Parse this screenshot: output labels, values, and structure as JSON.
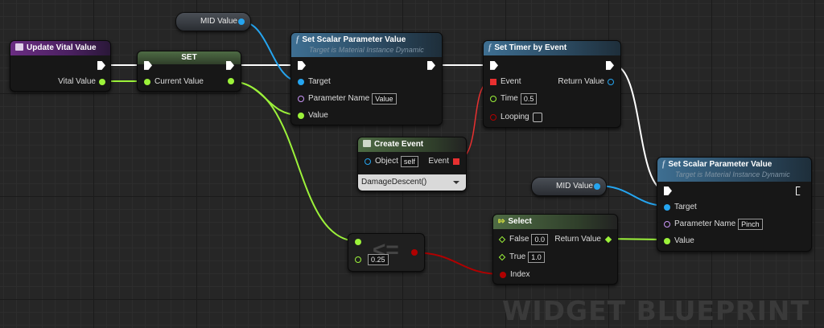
{
  "watermark": "WIDGET BLUEPRINT",
  "colors": {
    "exec": "#ffffff",
    "float": "#9cf23a",
    "object": "#25a5f0",
    "name": "#c996f7",
    "delegate": "#e83030",
    "bool": "#b00000",
    "select": "#9cf23a"
  },
  "event_node": {
    "title": "Update Vital Value",
    "pin_vital": "Vital Value"
  },
  "set_node": {
    "title": "SET",
    "pin_current": "Current Value"
  },
  "mid_value_1": {
    "label": "MID Value"
  },
  "mid_value_2": {
    "label": "MID Value"
  },
  "set_scalar_1": {
    "title": "Set Scalar Parameter Value",
    "subtitle": "Target is Material Instance Dynamic",
    "pin_target": "Target",
    "pin_param": "Parameter Name",
    "param_value": "Value",
    "pin_value": "Value"
  },
  "set_timer": {
    "title": "Set Timer by Event",
    "pin_event": "Event",
    "pin_return": "Return Value",
    "pin_time": "Time",
    "time_value": "0.5",
    "pin_looping": "Looping"
  },
  "create_event": {
    "title": "Create Event",
    "pin_object": "Object",
    "object_value": "self",
    "pin_event": "Event",
    "dropdown": "DamageDescent()"
  },
  "compare_node": {
    "symbol": "<=",
    "b_value": "0.25"
  },
  "select_node": {
    "title": "Select",
    "pin_false": "False",
    "false_value": "0.0",
    "pin_true": "True",
    "true_value": "1.0",
    "pin_return": "Return Value",
    "pin_index": "Index"
  },
  "set_scalar_2": {
    "title": "Set Scalar Parameter Value",
    "subtitle": "Target is Material Instance Dynamic",
    "pin_target": "Target",
    "pin_param": "Parameter Name",
    "param_value": "Pinch",
    "pin_value": "Value"
  }
}
